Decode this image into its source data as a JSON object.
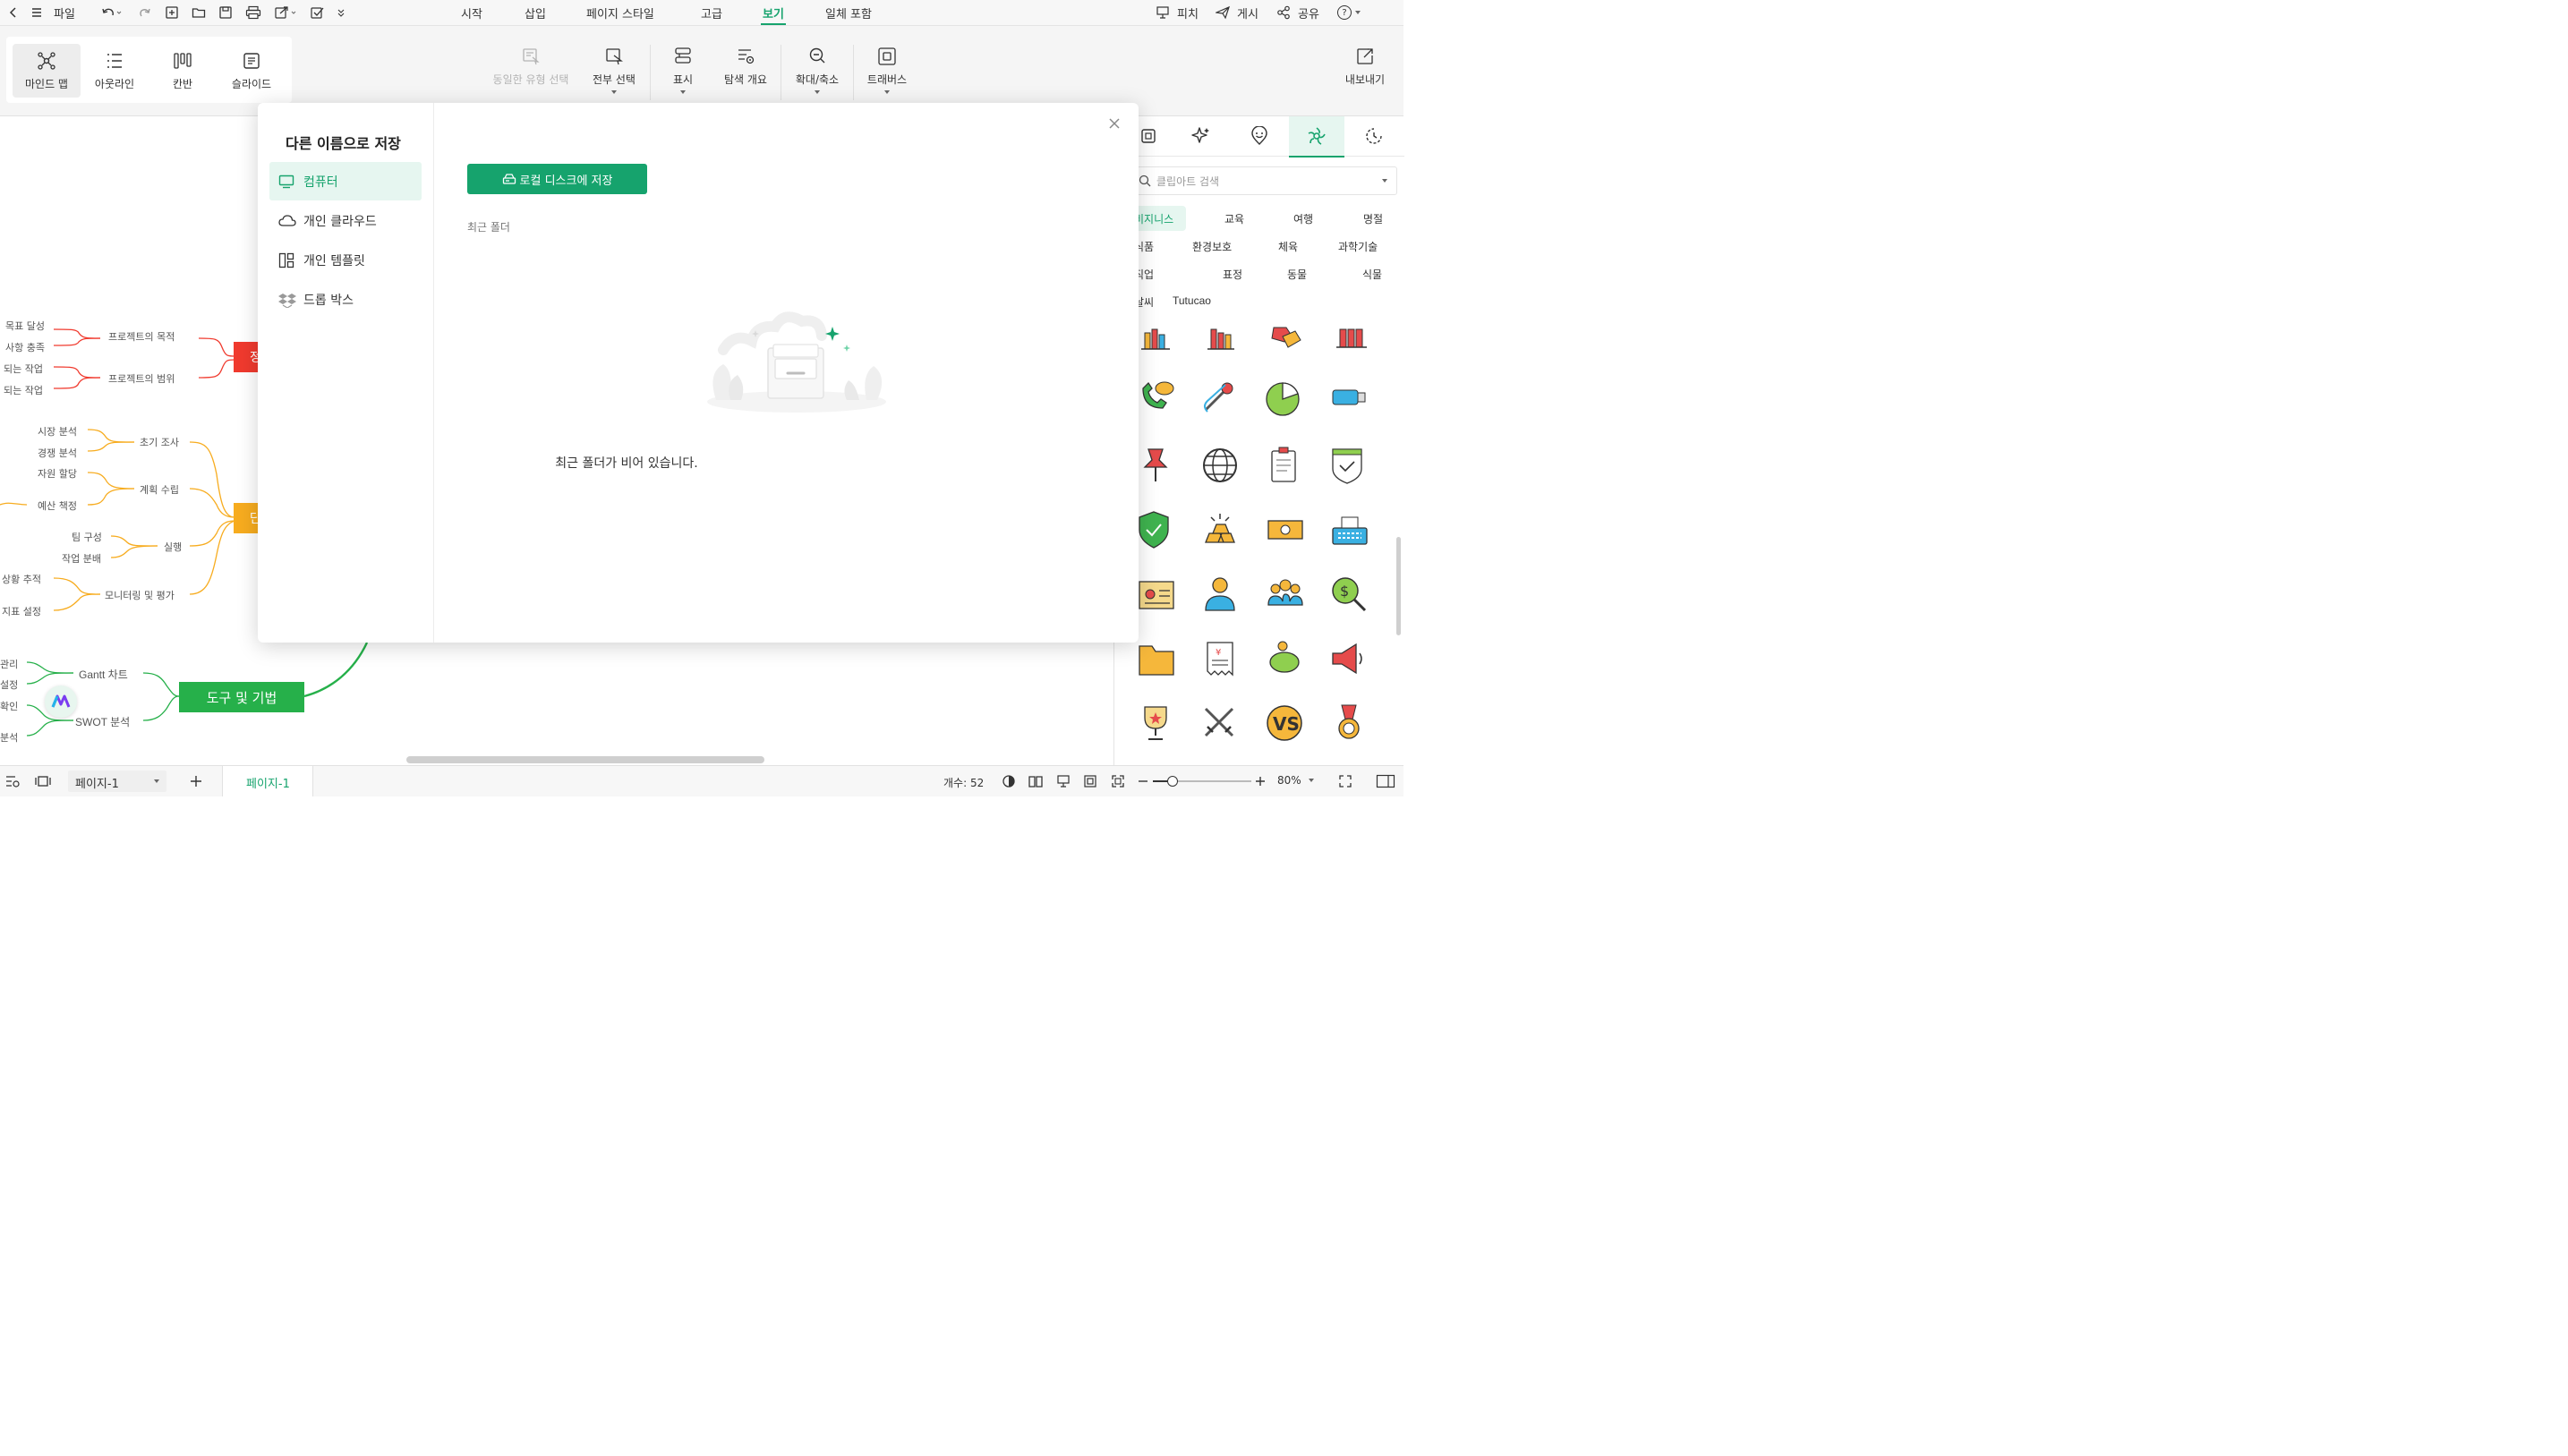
{
  "toolbar": {
    "file_label": "파일",
    "menu_tabs": [
      "시작",
      "삽입",
      "페이지 스타일",
      "고급",
      "보기",
      "일체 포함"
    ],
    "active_tab": "보기",
    "pitch_label": "피치",
    "publish_label": "게시",
    "share_label": "공유",
    "help_label": "?"
  },
  "ribbon": {
    "views": [
      "마인드 맵",
      "아웃라인",
      "칸반",
      "슬라이드"
    ],
    "select_same": "동일한 유형 선택",
    "select_all": "전부 선택",
    "display": "표시",
    "explore": "탐색 개요",
    "zoom": "확대/축소",
    "traverse": "트래버스",
    "export": "내보내기"
  },
  "dialog": {
    "title": "다른 이름으로 저장",
    "side_items": [
      "컴퓨터",
      "개인 클라우드",
      "개인 템플릿",
      "드롭 박스"
    ],
    "save_local_button": "로컬 디스크에 저장",
    "recent_folder_label": "최근 폴더",
    "empty_message": "최근 폴더가 비어 있습니다."
  },
  "mindmap": {
    "left_texts": [
      "목표 달성",
      "사항 충족",
      "되는 작업",
      "되는 작업",
      "시장 분석",
      "경쟁 분석",
      "자원 할당",
      "예산 책정",
      "팀 구성",
      "작업 분배",
      "상황 추적",
      "지표 설정",
      "관리",
      "설정",
      "확인",
      "분석"
    ],
    "branch_texts": [
      "프로젝트의 목적",
      "프로젝트의 범위",
      "초기 조사",
      "계획 수립",
      "실행",
      "모니터링 및 평가",
      "Gantt 차트",
      "SWOT 분석"
    ],
    "node_labels": [
      "정",
      "단"
    ],
    "tools_node": "도구 및 기법"
  },
  "clipart": {
    "search_placeholder": "클립아트 검색",
    "categories_row1": [
      "비지니스",
      "교육",
      "여행",
      "명절"
    ],
    "categories_row2": [
      "식품",
      "환경보호",
      "체육",
      "과학기술"
    ],
    "categories_row3": [
      "직업",
      "표정",
      "동물",
      "식물"
    ],
    "categories_row4": [
      "날씨",
      "Tutucao"
    ]
  },
  "status": {
    "page_select": "페이지-1",
    "page_tab": "페이지-1",
    "count_label": "개수: 52",
    "zoom": "80%"
  },
  "colors": {
    "accent": "#16a36d",
    "red_node": "#f03a2e",
    "orange_node": "#f7ac1f",
    "green_node": "#26b04a"
  }
}
